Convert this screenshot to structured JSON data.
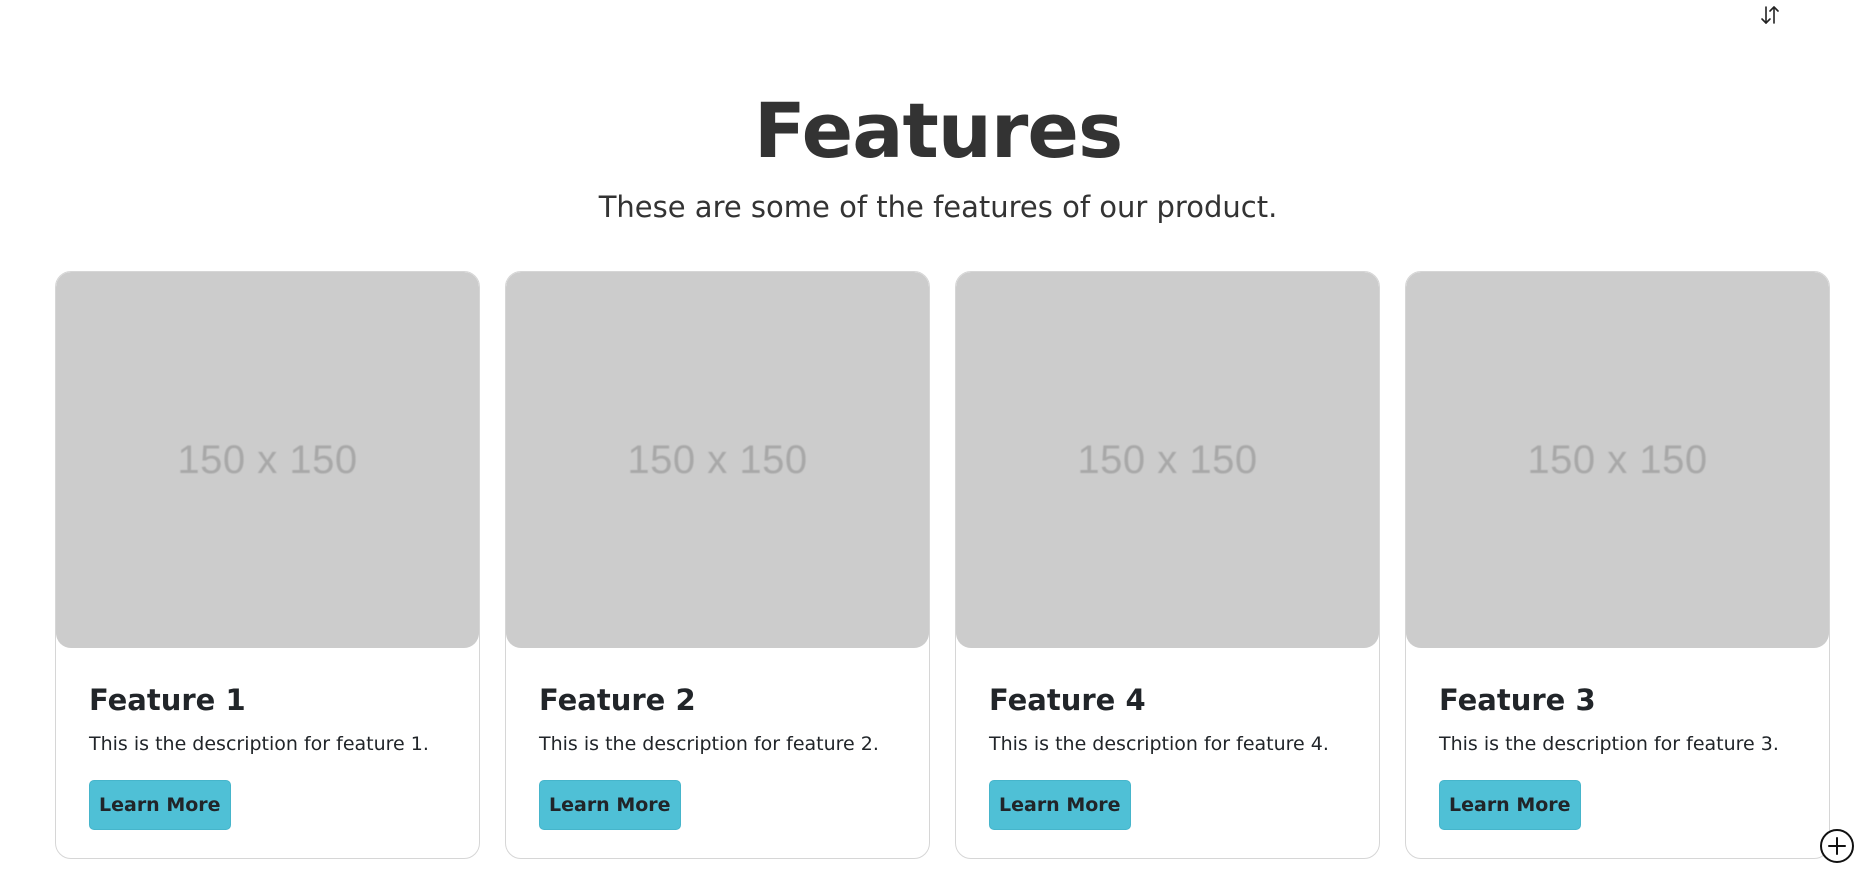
{
  "toolbar": {
    "sort_icon": "sort-arrows-icon"
  },
  "header": {
    "title": "Features",
    "subtitle": "These are some of the features of our product."
  },
  "cards": [
    {
      "image_label": "150 x 150",
      "title": "Feature 1",
      "description": "This is the description for feature 1.",
      "button_label": "Learn More"
    },
    {
      "image_label": "150 x 150",
      "title": "Feature 2",
      "description": "This is the description for feature 2.",
      "button_label": "Learn More"
    },
    {
      "image_label": "150 x 150",
      "title": "Feature 4",
      "description": "This is the description for feature 4.",
      "button_label": "Learn More"
    },
    {
      "image_label": "150 x 150",
      "title": "Feature 3",
      "description": "This is the description for feature 3.",
      "button_label": "Learn More"
    }
  ],
  "floating_action": {
    "icon": "add-circle-icon"
  },
  "colors": {
    "accent": "#4fc0d6",
    "placeholder": "#cccccc",
    "heading": "#333333"
  }
}
